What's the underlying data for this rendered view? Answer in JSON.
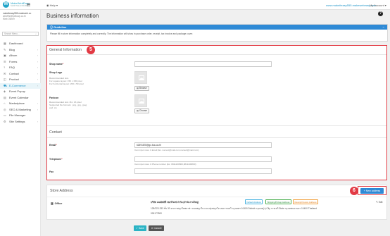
{
  "app": {
    "logo_text": "MakeWebEasy",
    "logo_sub": "SHOP SALE ONLINE",
    "logo_letter": "M"
  },
  "topbar": {
    "help": "Help",
    "shop_url": "www.makeiteasy555.makewebeasy.com",
    "account": "My Account"
  },
  "user": {
    "name": "makeiteasy555.makeweb.co",
    "email": "ADMIN@tyellowp.co.th",
    "role": "Web Owner"
  },
  "search": {
    "placeholder": "Search Menu..."
  },
  "menu": [
    {
      "label": "Dashboard",
      "icon": "dashboard-icon",
      "glyph": "▦",
      "arrow": ""
    },
    {
      "label": "Blog",
      "icon": "blog-icon",
      "glyph": "✎",
      "arrow": "›"
    },
    {
      "label": "Album",
      "icon": "album-icon",
      "glyph": "▣",
      "arrow": "›"
    },
    {
      "label": "Forms",
      "icon": "forms-icon",
      "glyph": "☰",
      "arrow": "›"
    },
    {
      "label": "FAQ",
      "icon": "faq-icon",
      "glyph": "?",
      "arrow": "›"
    },
    {
      "label": "Contact",
      "icon": "contact-icon",
      "glyph": "✉",
      "arrow": "›"
    },
    {
      "label": "Product",
      "icon": "product-icon",
      "glyph": "◫",
      "arrow": "›"
    },
    {
      "label": "E-Commerce",
      "icon": "cart-icon",
      "glyph": "⛟",
      "arrow": "›"
    },
    {
      "label": "Event Popup",
      "icon": "popup-icon",
      "glyph": "◈",
      "arrow": ""
    },
    {
      "label": "Event Calendar",
      "icon": "calendar-icon",
      "glyph": "▤",
      "arrow": ""
    },
    {
      "label": "Marketplace",
      "icon": "marketplace-icon",
      "glyph": "⌂",
      "arrow": "›"
    },
    {
      "label": "SEO & Marketing",
      "icon": "seo-icon",
      "glyph": "◎",
      "arrow": "›"
    },
    {
      "label": "File Manager",
      "icon": "folder-icon",
      "glyph": "▭",
      "arrow": ""
    },
    {
      "label": "Site Settings",
      "icon": "gear-icon",
      "glyph": "⚙",
      "arrow": "›"
    }
  ],
  "page": {
    "title": "Business information",
    "help_glyph": "?"
  },
  "guide": {
    "title": "Guideline",
    "text": "Please fill in store information completely and correctly. The information will show in purchase order, receipt, tax invoice and package cover."
  },
  "general": {
    "title": "General Information",
    "marker": "5",
    "shop_name_label": "Shop name",
    "shop_name_value": "",
    "logo_label": "Shop Logo",
    "logo_hint_title": "Recommended size",
    "logo_hint_1": "For square layout: 150 x 150 pixel",
    "logo_hint_2": "For horizontal layout: 200 x 50 pixel",
    "browse_label": "Browse",
    "favicon_label": "Favicon",
    "favicon_hint_1": "Recommended size 16 x 16 pixel",
    "favicon_hint_2": "Supported file formats: .png, .jpg, .jpeg",
    "favicon_hint_3": "and .ico",
    "choose_label": "Choose"
  },
  "contact": {
    "title": "Contact",
    "email_label": "Email",
    "email_value": "62691878@go.buu.ac.th",
    "email_hint": "Can input more 1 Email (Ex. name1@mail.com,name2@mail.com)",
    "phone_label": "Telephone",
    "phone_value": "",
    "phone_hint": "Can input more 1 Phone number (Ex. 0811100800,0811100800)",
    "fax_label": "Fax",
    "fax_value": ""
  },
  "store": {
    "title": "Store Address",
    "marker": "6",
    "new_button": "+ New address",
    "office_label": "Office",
    "name": "บริษัท เมคอิทอีซี่ เซอร์วิสเซ่ จำกัด (สำนักงานใหญ่)",
    "badge_default": "Default Address",
    "badge_shipping": "Shipping/Pickup Address",
    "badge_receipt": "Receipt/Invoice Address",
    "edit": "Edit",
    "address": "128/323-333 ชั้น 30 อาคารพญาไทพลาซ่า ถนนพญาไท แขวงทุ่งพญาไท เขตราชเทวี กรุงเทพฯ 10400  District กรุงเทพ(ฯ) City ราชเทวี State กรุงเทพมหานคร 10400 Thailand",
    "phone": "026177800"
  },
  "actions": {
    "save": "Save",
    "cancel": "Cancel"
  },
  "colors": {
    "accent": "#2e8ad6",
    "highlight": "#e23a44",
    "teal": "#2bb3c4"
  }
}
